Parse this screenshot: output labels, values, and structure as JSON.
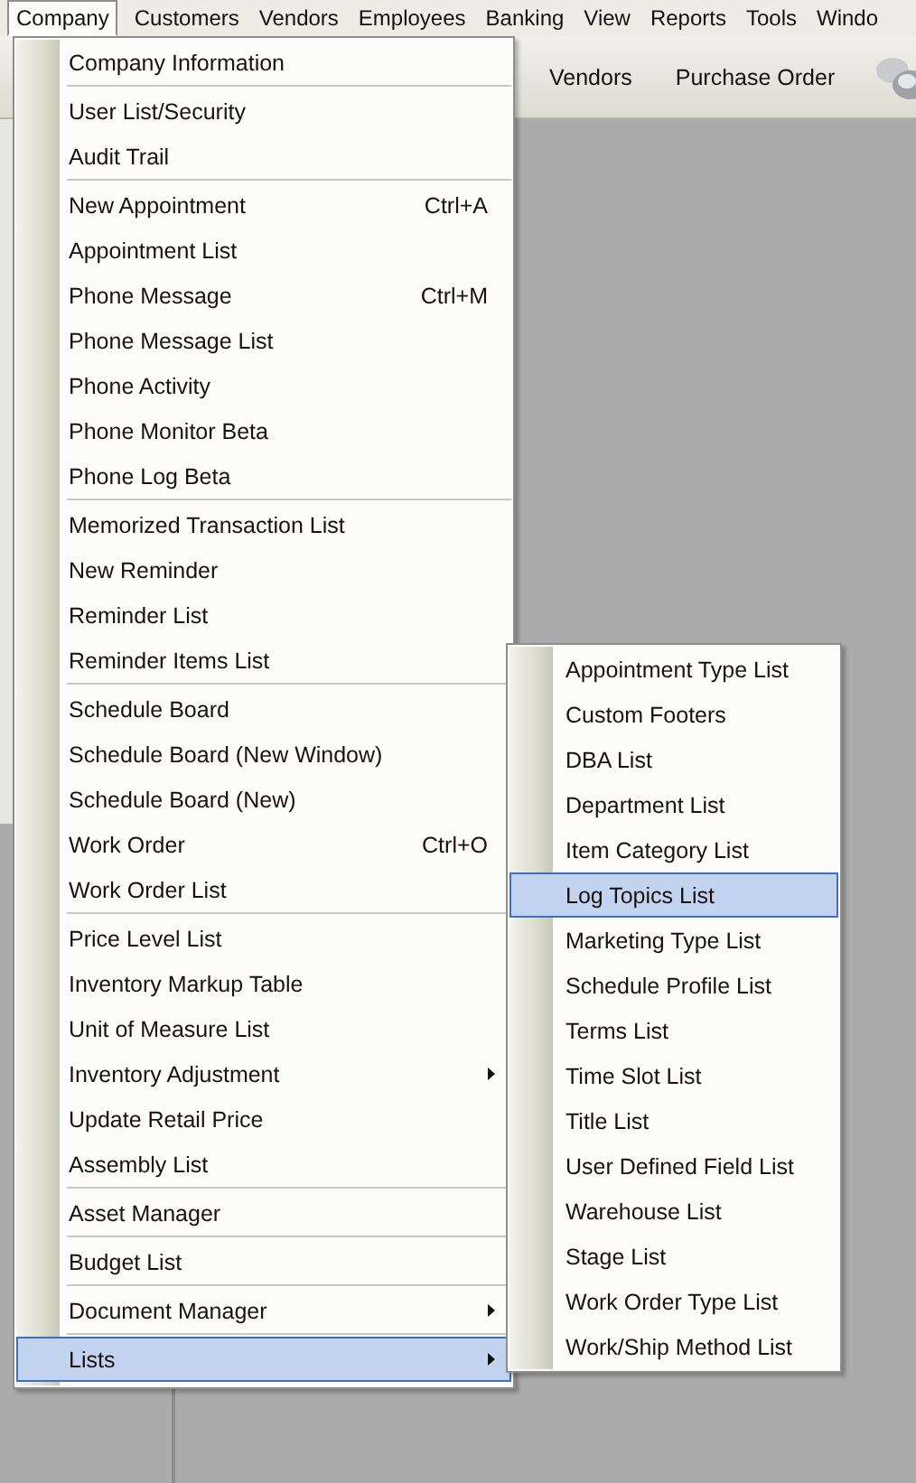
{
  "menubar": [
    {
      "label": "Company",
      "selected": true
    },
    {
      "label": "Customers",
      "selected": false
    },
    {
      "label": "Vendors",
      "selected": false
    },
    {
      "label": "Employees",
      "selected": false
    },
    {
      "label": "Banking",
      "selected": false
    },
    {
      "label": "View",
      "selected": false
    },
    {
      "label": "Reports",
      "selected": false
    },
    {
      "label": "Tools",
      "selected": false
    },
    {
      "label": "Windo",
      "selected": false
    }
  ],
  "toolbar": [
    {
      "label": "Vendors",
      "kind": "plain"
    },
    {
      "label": "Purchase Order",
      "kind": "form"
    }
  ],
  "company_menu": {
    "groups": [
      [
        {
          "label": "Company Information",
          "selected": false
        }
      ],
      [
        {
          "label": "User List/Security",
          "selected": false
        },
        {
          "label": "Audit Trail",
          "selected": false
        }
      ],
      [
        {
          "label": "New Appointment",
          "shortcut": "Ctrl+A",
          "selected": false
        },
        {
          "label": "Appointment List",
          "selected": false
        },
        {
          "label": "Phone Message",
          "shortcut": "Ctrl+M",
          "selected": false
        },
        {
          "label": "Phone Message List",
          "selected": false
        },
        {
          "label": "Phone Activity",
          "selected": false
        },
        {
          "label": "Phone Monitor Beta",
          "selected": false
        },
        {
          "label": "Phone Log Beta",
          "selected": false
        }
      ],
      [
        {
          "label": "Memorized Transaction List",
          "selected": false
        },
        {
          "label": "New Reminder",
          "selected": false
        },
        {
          "label": "Reminder List",
          "selected": false
        },
        {
          "label": "Reminder Items List",
          "selected": false
        }
      ],
      [
        {
          "label": "Schedule Board",
          "selected": false
        },
        {
          "label": "Schedule Board (New Window)",
          "selected": false
        },
        {
          "label": "Schedule Board (New)",
          "selected": false
        },
        {
          "label": "Work Order",
          "shortcut": "Ctrl+O",
          "selected": false
        },
        {
          "label": "Work Order List",
          "selected": false
        }
      ],
      [
        {
          "label": "Price Level List",
          "selected": false
        },
        {
          "label": "Inventory Markup Table",
          "selected": false
        },
        {
          "label": "Unit of Measure List",
          "selected": false
        },
        {
          "label": "Inventory Adjustment",
          "submenu": true,
          "selected": false
        },
        {
          "label": "Update Retail Price",
          "selected": false
        },
        {
          "label": "Assembly List",
          "selected": false
        }
      ],
      [
        {
          "label": "Asset Manager",
          "selected": false
        }
      ],
      [
        {
          "label": "Budget List",
          "selected": false
        }
      ],
      [
        {
          "label": "Document Manager",
          "submenu": true,
          "selected": false
        }
      ],
      [
        {
          "label": "Lists",
          "submenu": true,
          "selected": true
        }
      ]
    ]
  },
  "lists_submenu": {
    "items": [
      {
        "label": "Appointment Type List",
        "selected": false
      },
      {
        "label": "Custom Footers",
        "selected": false
      },
      {
        "label": "DBA List",
        "selected": false
      },
      {
        "label": "Department List",
        "selected": false
      },
      {
        "label": "Item Category List",
        "selected": false
      },
      {
        "label": "Log Topics List",
        "selected": true
      },
      {
        "label": "Marketing Type List",
        "selected": false
      },
      {
        "label": "Schedule Profile List",
        "selected": false
      },
      {
        "label": "Terms List",
        "selected": false
      },
      {
        "label": "Time Slot List",
        "selected": false
      },
      {
        "label": "Title List",
        "selected": false
      },
      {
        "label": "User Defined Field List",
        "selected": false
      },
      {
        "label": "Warehouse List",
        "selected": false
      },
      {
        "label": "Stage List",
        "selected": false
      },
      {
        "label": "Work Order Type List",
        "selected": false
      },
      {
        "label": "Work/Ship Method List",
        "selected": false
      }
    ]
  }
}
